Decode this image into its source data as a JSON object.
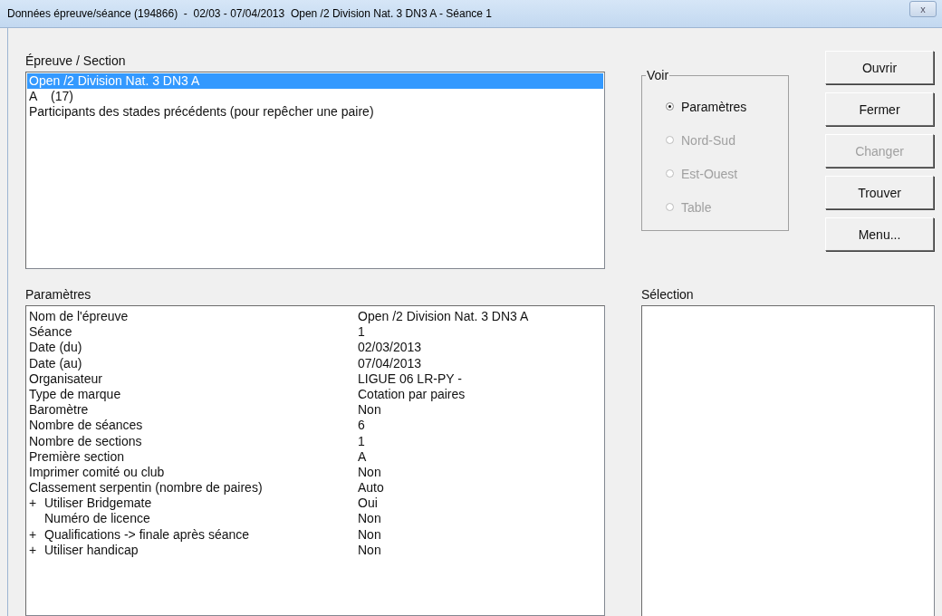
{
  "window": {
    "title": "Données épreuve/séance (194866)  -  02/03 - 07/04/2013  Open /2 Division Nat. 3 DN3 A - Séance 1",
    "close": "x"
  },
  "sections": {
    "label": "Épreuve / Section",
    "items": [
      {
        "text": "Open /2 Division Nat. 3 DN3 A",
        "selected": true
      },
      {
        "text": "A    (17)",
        "selected": false
      },
      {
        "text": "Participants des stades précédents (pour repêcher une paire)",
        "selected": false
      }
    ]
  },
  "voir": {
    "label": "Voir",
    "options": [
      {
        "label": "Paramètres",
        "selected": true,
        "disabled": false
      },
      {
        "label": "Nord-Sud",
        "selected": false,
        "disabled": true
      },
      {
        "label": "Est-Ouest",
        "selected": false,
        "disabled": true
      },
      {
        "label": "Table",
        "selected": false,
        "disabled": true
      }
    ]
  },
  "buttons": [
    {
      "label": "Ouvrir",
      "disabled": false
    },
    {
      "label": "Fermer",
      "disabled": false
    },
    {
      "label": "Changer",
      "disabled": true
    },
    {
      "label": "Trouver",
      "disabled": false
    },
    {
      "label": "Menu...",
      "disabled": false
    }
  ],
  "parameters": {
    "label": "Paramètres",
    "rows": [
      {
        "kind": "plain",
        "name": "Nom de l'épreuve",
        "value": "Open /2 Division Nat. 3 DN3 A"
      },
      {
        "kind": "plain",
        "name": "Séance",
        "value": "1"
      },
      {
        "kind": "plain",
        "name": "Date (du)",
        "value": "02/03/2013"
      },
      {
        "kind": "plain",
        "name": "Date (au)",
        "value": "07/04/2013"
      },
      {
        "kind": "plain",
        "name": "Organisateur",
        "value": "LIGUE 06 LR-PY -"
      },
      {
        "kind": "plain",
        "name": "Type de marque",
        "value": "Cotation par paires"
      },
      {
        "kind": "plain",
        "name": "Baromètre",
        "value": "Non"
      },
      {
        "kind": "plain",
        "name": "Nombre de séances",
        "value": "6"
      },
      {
        "kind": "plain",
        "name": "Nombre de sections",
        "value": "1"
      },
      {
        "kind": "plain",
        "name": "Première section",
        "value": "A"
      },
      {
        "kind": "plain",
        "name": "Imprimer comité ou club",
        "value": "Non"
      },
      {
        "kind": "plain",
        "name": "Classement serpentin (nombre de paires)",
        "value": "Auto"
      },
      {
        "kind": "group",
        "marker": "+",
        "name": "Utiliser Bridgemate",
        "value": "Oui"
      },
      {
        "kind": "child",
        "name": "Numéro de licence",
        "value": "Non"
      },
      {
        "kind": "group",
        "marker": "+",
        "name": "Qualifications -> finale après séance",
        "value": "Non"
      },
      {
        "kind": "group",
        "marker": "+",
        "name": "Utiliser handicap",
        "value": "Non"
      }
    ]
  },
  "selection": {
    "label": "Sélection"
  }
}
